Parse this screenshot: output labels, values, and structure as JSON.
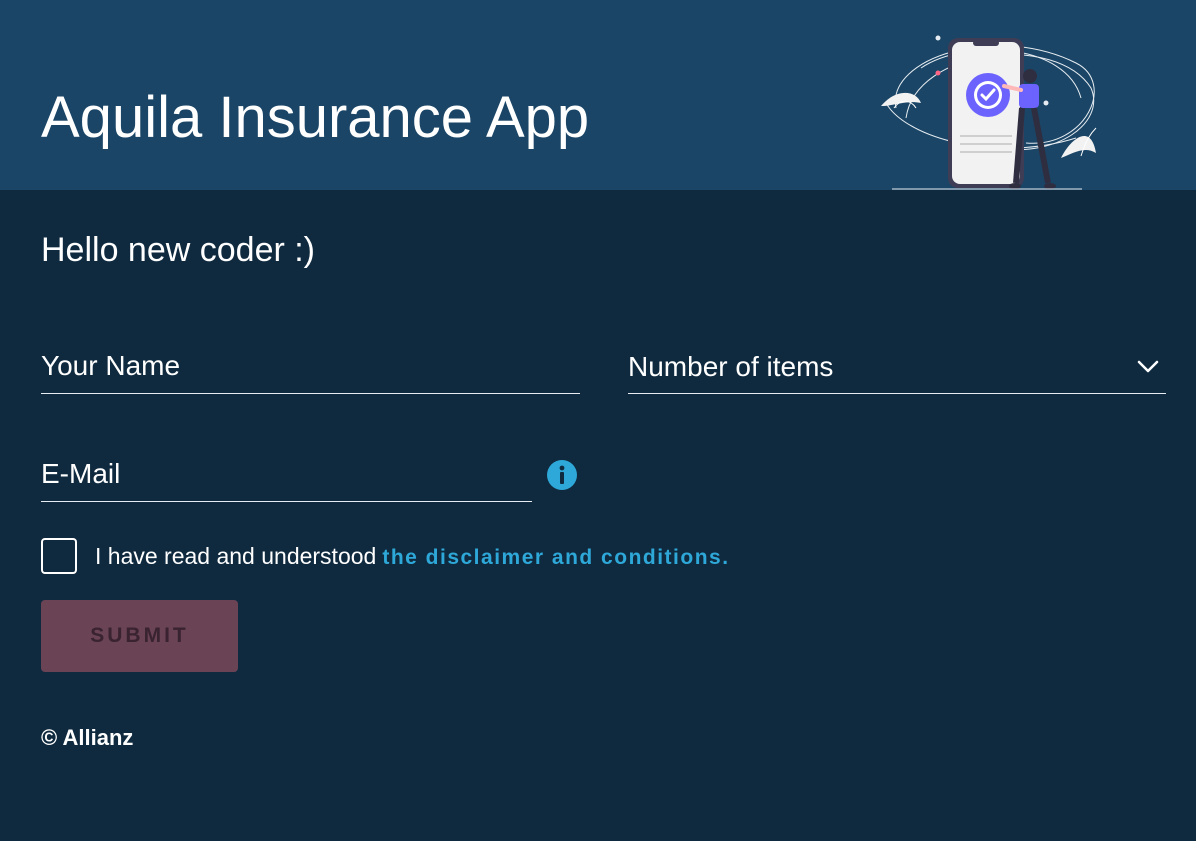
{
  "header": {
    "title": "Aquila Insurance App",
    "background": "#1a4566"
  },
  "main": {
    "greeting": "Hello new coder :)",
    "background": "#0f2a3f"
  },
  "form": {
    "name_placeholder": "Your Name",
    "items_label": "Number of items",
    "email_placeholder": "E-Mail",
    "consent_text": "I have read and understood",
    "consent_link": "the disclaimer and conditions.",
    "submit_label": "SUBMIT",
    "consent_checked": false,
    "submit_disabled": true
  },
  "icons": {
    "info": "info-icon",
    "chevron": "chevron-down-icon"
  },
  "colors": {
    "accent": "#2ea8d8",
    "submit_bg": "#6a4355",
    "illustration_accent": "#6c63ff"
  },
  "footer": {
    "copyright": "© Allianz"
  }
}
